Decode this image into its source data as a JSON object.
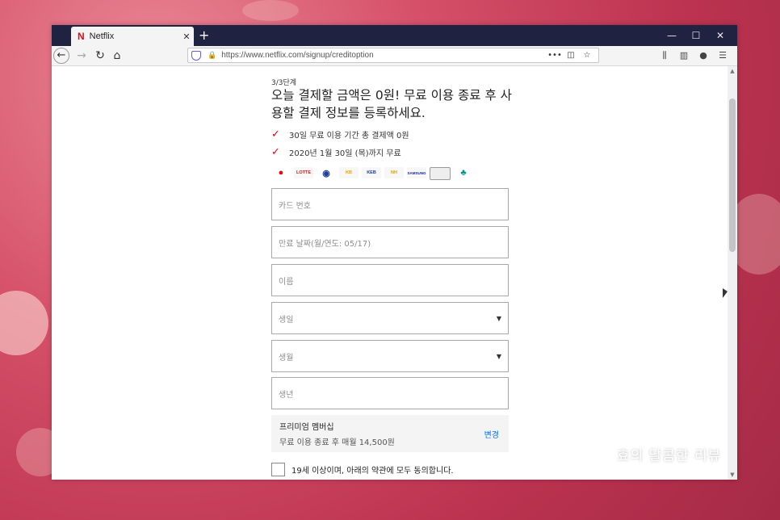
{
  "browser": {
    "tab_title": "Netflix",
    "favicon": "N",
    "tab_close": "✕",
    "new_tab": "+",
    "url": "https://www.netflix.com/signup/creditoption",
    "url_more": "•••",
    "window_controls": [
      "—",
      "☐",
      "✕"
    ]
  },
  "page": {
    "step": "3/3단계",
    "heading": "오늘 결제할 금액은 0원! 무료 이용 종료 후 사용할 결제 정보를 등록하세요.",
    "checks": [
      "30일 무료 이용 기간 총 결제액 0원",
      "2020년 1월 30일 (목)까지 무료"
    ],
    "card_logos": [
      "lotte",
      "LOTTE",
      "shinhan",
      "KB",
      "KEB",
      "NH",
      "SAMSUNG",
      "card",
      "hana"
    ],
    "fields": {
      "card_number": "카드 번호",
      "expiry": "만료 날짜(월/연도: 05/17)",
      "name": "이름",
      "birth_day": "생일",
      "birth_month": "생월",
      "birth_year": "생년"
    },
    "membership": {
      "plan": "프리미엄 멤버십",
      "price": "무료 이용 종료 후 매월 14,500원",
      "change": "변경"
    },
    "agree": "19세 이상이며, 아래의 약관에 모두 동의합니다."
  },
  "watermark": "효의 달콤한 리뷰",
  "colors": {
    "accent_red": "#e50914",
    "link_blue": "#0071eb",
    "titlebar": "#1f2240"
  }
}
